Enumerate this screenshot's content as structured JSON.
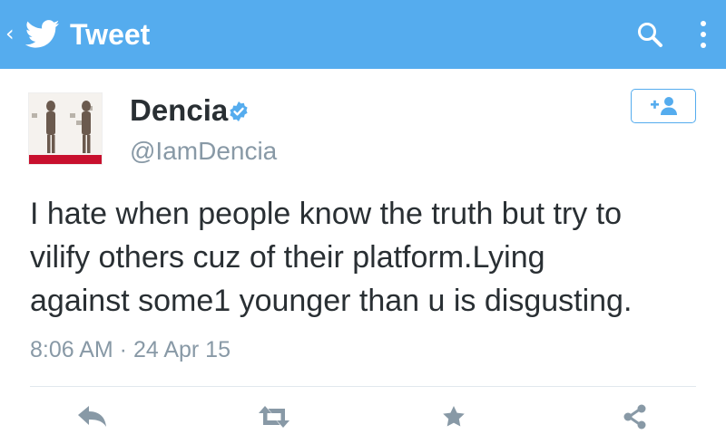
{
  "app_bar": {
    "title": "Tweet",
    "back_icon": "chevron-left-icon",
    "logo_icon": "twitter-bird-icon",
    "search_icon": "search-icon",
    "overflow_icon": "more-vertical-icon",
    "color": "#55acee"
  },
  "tweet": {
    "author_name": "Dencia",
    "author_handle": "@IamDencia",
    "verified": true,
    "text": "I hate when people  know the truth but try to\nvilify others cuz of their platform.Lying\nagainst some1 younger than u is disgusting.",
    "timestamp": "8:06 AM · 24 Apr 15"
  },
  "actions": {
    "reply_icon": "reply-icon",
    "retweet_icon": "retweet-icon",
    "favorite_icon": "star-icon",
    "share_icon": "share-icon",
    "follow_icon": "add-user-icon"
  },
  "colors": {
    "accent": "#55acee",
    "text": "#292f33",
    "muted": "#8899a6",
    "divider": "#e1e8ed"
  }
}
